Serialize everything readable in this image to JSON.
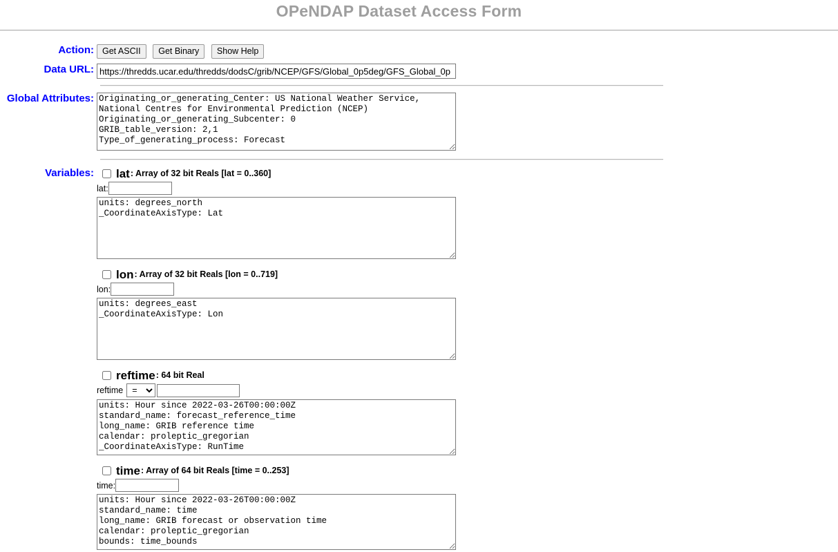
{
  "header": {
    "title": "OPeNDAP Dataset Access Form"
  },
  "colors": {
    "label_blue": "#0000FF",
    "title_gray": "#9E9E9E",
    "button_face": "#F0F0F0",
    "border_gray": "#7A7A7A"
  },
  "action": {
    "label": "Action:",
    "buttons": [
      {
        "name": "get-ascii",
        "label": "Get ASCII"
      },
      {
        "name": "get-binary",
        "label": "Get Binary"
      },
      {
        "name": "show-help",
        "label": "Show Help"
      }
    ]
  },
  "data_url": {
    "label": "Data URL:",
    "value": "https://thredds.ucar.edu/thredds/dodsC/grib/NCEP/GFS/Global_0p5deg/GFS_Global_0p",
    "placeholder": ""
  },
  "global_attributes": {
    "label": "Global Attributes:",
    "text": "Originating_or_generating_Center: US National Weather Service,\nNational Centres for Environmental Prediction (NCEP)\nOriginating_or_generating_Subcenter: 0\nGRIB_table_version: 2,1\nType_of_generating_process: Forecast",
    "has_scrollbar": true
  },
  "variables": {
    "label": "Variables:",
    "items": [
      {
        "name": "lat",
        "type": "Array of 32 bit Reals [lat = 0..360]",
        "checked": false,
        "index_label": "lat:",
        "index_value": "",
        "operator": null,
        "attributes": "units: degrees_north\n_CoordinateAxisType: Lat",
        "has_scrollbar": false
      },
      {
        "name": "lon",
        "type": "Array of 32 bit Reals [lon = 0..719]",
        "checked": false,
        "index_label": "lon:",
        "index_value": "",
        "operator": null,
        "attributes": "units: degrees_east\n_CoordinateAxisType: Lon",
        "has_scrollbar": false
      },
      {
        "name": "reftime",
        "type": "64 bit Real",
        "checked": false,
        "index_label": "reftime",
        "index_value": "",
        "operator": "=",
        "operator_options": [
          "=",
          "<",
          ">",
          "<=",
          ">=",
          "!="
        ],
        "attributes": "units: Hour since 2022-03-26T00:00:00Z\nstandard_name: forecast_reference_time\nlong_name: GRIB reference time\ncalendar: proleptic_gregorian\n_CoordinateAxisType: RunTime",
        "has_scrollbar": true
      },
      {
        "name": "time",
        "type": "Array of 64 bit Reals [time = 0..253]",
        "checked": false,
        "index_label": "time:",
        "index_value": "",
        "operator": null,
        "attributes": "units: Hour since 2022-03-26T00:00:00Z\nstandard_name: time\nlong_name: GRIB forecast or observation time\ncalendar: proleptic_gregorian\nbounds: time_bounds",
        "has_scrollbar": true
      }
    ]
  }
}
